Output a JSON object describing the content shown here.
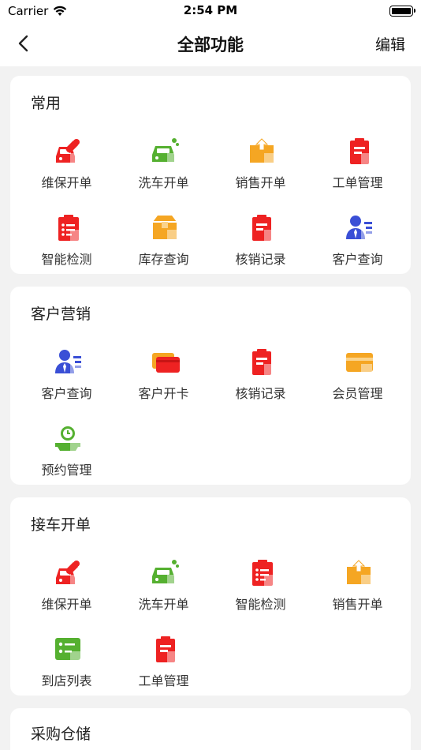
{
  "status_bar": {
    "carrier": "Carrier",
    "time": "2:54 PM"
  },
  "nav": {
    "title": "全部功能",
    "edit_label": "编辑"
  },
  "colors": {
    "red": "#ee2222",
    "green": "#55b030",
    "orange": "#f5a623",
    "blue": "#3a4fd6"
  },
  "sections": [
    {
      "title": "常用",
      "items": [
        {
          "label": "维保开单",
          "icon": "car-wrench-icon"
        },
        {
          "label": "洗车开单",
          "icon": "car-wash-icon"
        },
        {
          "label": "销售开单",
          "icon": "sales-box-icon"
        },
        {
          "label": "工单管理",
          "icon": "clipboard-icon"
        },
        {
          "label": "智能检测",
          "icon": "checklist-icon"
        },
        {
          "label": "库存查询",
          "icon": "inventory-box-icon"
        },
        {
          "label": "核销记录",
          "icon": "record-icon"
        },
        {
          "label": "客户查询",
          "icon": "customer-icon"
        }
      ]
    },
    {
      "title": "客户营销",
      "items": [
        {
          "label": "客户查询",
          "icon": "customer-icon"
        },
        {
          "label": "客户开卡",
          "icon": "card-open-icon"
        },
        {
          "label": "核销记录",
          "icon": "record-icon"
        },
        {
          "label": "会员管理",
          "icon": "member-card-icon"
        },
        {
          "label": "预约管理",
          "icon": "appointment-icon"
        }
      ]
    },
    {
      "title": "接车开单",
      "items": [
        {
          "label": "维保开单",
          "icon": "car-wrench-icon"
        },
        {
          "label": "洗车开单",
          "icon": "car-wash-icon"
        },
        {
          "label": "智能检测",
          "icon": "checklist-icon"
        },
        {
          "label": "销售开单",
          "icon": "sales-box-icon"
        },
        {
          "label": "到店列表",
          "icon": "arrival-list-icon"
        },
        {
          "label": "工单管理",
          "icon": "clipboard-icon"
        }
      ]
    },
    {
      "title": "采购仓储",
      "items": []
    }
  ]
}
